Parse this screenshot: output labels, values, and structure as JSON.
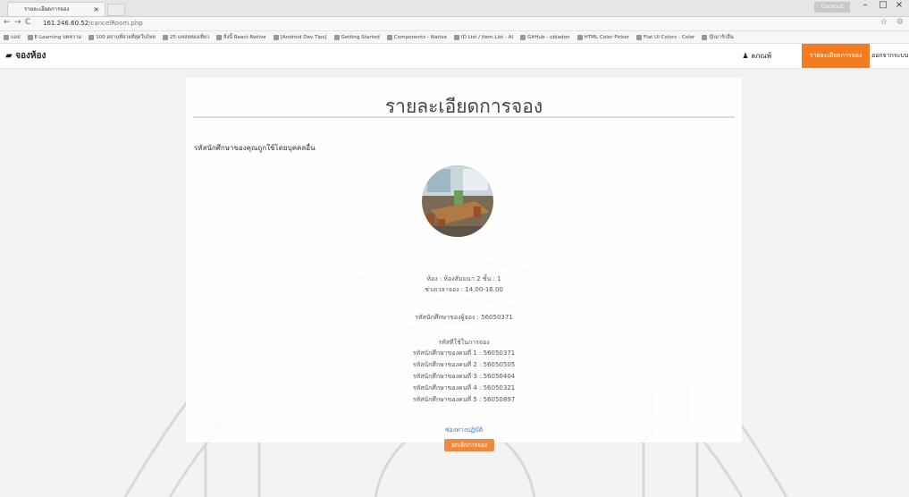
{
  "browser": {
    "tab_title": "รายละเอียดการจอง",
    "tab_close": "×",
    "window_user": "Coconut",
    "url_host": "161.246.60.52",
    "url_path": "/cancelRoom.php",
    "bookmarks": [
      "แอป",
      "E-Learning บทความ",
      "100 สถานที่สวยที่สุดในไทย",
      "25 แหล่งท่องเที่ยว",
      "สิ่งนี้ React-Native",
      "[Android Dev Tips]",
      "Getting Started",
      "Components - Native",
      "ID List / Item List - Al",
      "GitHub - obladon",
      "HTML Color Picker",
      "Flat UI Colors - Color",
      "บุ๊กมาร์กอื่น"
    ]
  },
  "navbar": {
    "brand": "จองห้อง",
    "user": "ลภณพ์",
    "active_item": "รายละเอียดการจอง",
    "logout": "ออกจากระบบ"
  },
  "content": {
    "title": "รายละเอียดการจอง",
    "message": "รหัสนักศึกษาของคุณถูกใช้โดยบุคคลอื่น",
    "room_line": "ห้อง : ห้องสัมมนา 2 ชั้น : 1",
    "time_line": "ช่วงเวลาจอง : 14.00-16.00",
    "booker_line": "รหัสนักศึกษาของผู้จอง : 56050371",
    "users_heading": "รหัสที่ใช้ในการจอง",
    "users": [
      "รหัสนักศึกษาของคนที่ 1 : 56050371",
      "รหัสนักศึกษาของคนที่ 2 : 56050505",
      "รหัสนักศึกษาของคนที่ 3 : 56050404",
      "รหัสนักศึกษาของคนที่ 4 : 56050321",
      "รหัสนักศึกษาของคนที่ 5 : 56050897"
    ],
    "link_text": "ช่องทางปฏิบัติ",
    "button_label": "ยกเลิกการจอง"
  },
  "colors": {
    "accent": "#f47c20",
    "button": "#f0883e",
    "link": "#3a7bd5"
  }
}
